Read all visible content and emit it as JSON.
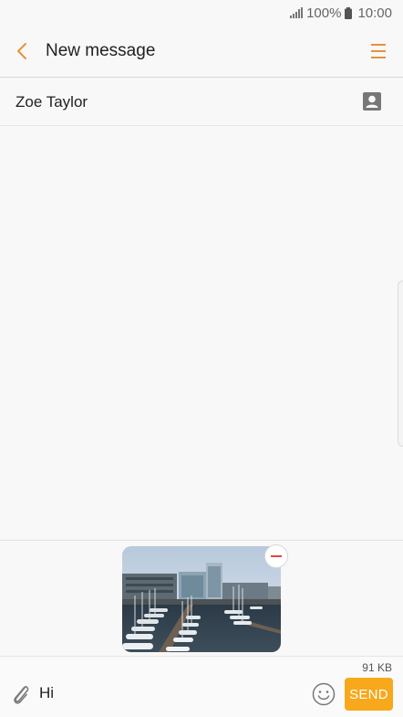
{
  "status_bar": {
    "battery": "100%",
    "time": "10:00",
    "icons": [
      "signal-icon",
      "battery-icon"
    ]
  },
  "header": {
    "title": "New message",
    "back_icon": "chevron-left-icon",
    "menu_icon": "menu-icon",
    "accent_color": "#e8913a"
  },
  "recipient": {
    "name": "Zoe Taylor",
    "contact_icon": "contact-card-icon"
  },
  "attachment": {
    "type": "image",
    "description_icon": "photo-thumbnail",
    "remove_icon": "remove-icon"
  },
  "composer": {
    "message_size": "91 KB",
    "message_text": "Hi",
    "send_label": "SEND",
    "attach_icon": "paperclip-icon",
    "emoji_icon": "emoji-icon",
    "send_color": "#f7a81b"
  }
}
